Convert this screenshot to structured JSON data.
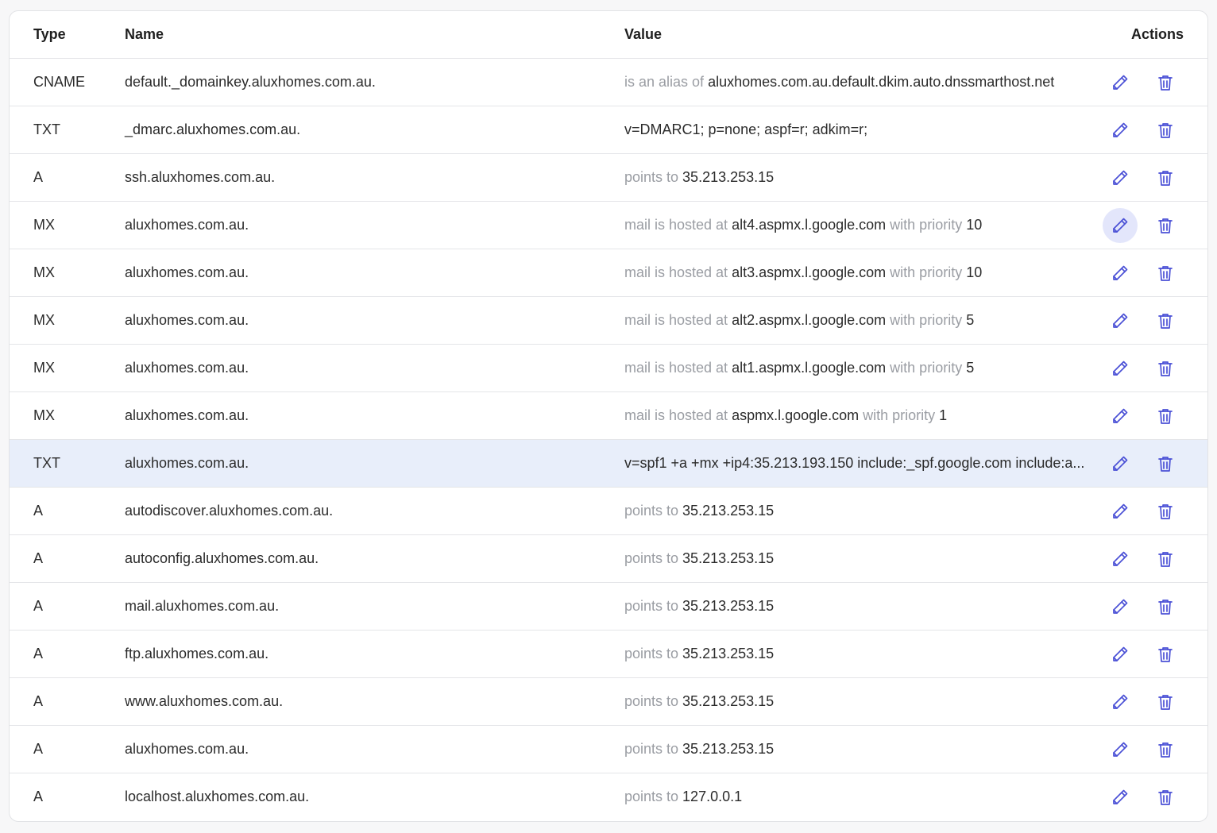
{
  "table": {
    "headers": {
      "type": "Type",
      "name": "Name",
      "value": "Value",
      "actions": "Actions"
    },
    "highlighted_row_index": 8,
    "active_edit_row_index": 3,
    "icon_color": "#4b51d6",
    "rows": [
      {
        "type": "CNAME",
        "name": "default._domainkey.aluxhomes.com.au.",
        "value_parts": [
          {
            "t": "is an alias of ",
            "muted": true
          },
          {
            "t": "aluxhomes.com.au.default.dkim.auto.dnssmarthost.net",
            "muted": false
          }
        ]
      },
      {
        "type": "TXT",
        "name": "_dmarc.aluxhomes.com.au.",
        "value_parts": [
          {
            "t": "v=DMARC1; p=none; aspf=r; adkim=r;",
            "muted": false
          }
        ]
      },
      {
        "type": "A",
        "name": "ssh.aluxhomes.com.au.",
        "value_parts": [
          {
            "t": "points to ",
            "muted": true
          },
          {
            "t": "35.213.253.15",
            "muted": false
          }
        ]
      },
      {
        "type": "MX",
        "name": "aluxhomes.com.au.",
        "value_parts": [
          {
            "t": "mail is hosted at ",
            "muted": true
          },
          {
            "t": "alt4.aspmx.l.google.com",
            "muted": false
          },
          {
            "t": " with priority ",
            "muted": true
          },
          {
            "t": "10",
            "muted": false
          }
        ]
      },
      {
        "type": "MX",
        "name": "aluxhomes.com.au.",
        "value_parts": [
          {
            "t": "mail is hosted at ",
            "muted": true
          },
          {
            "t": "alt3.aspmx.l.google.com",
            "muted": false
          },
          {
            "t": " with priority ",
            "muted": true
          },
          {
            "t": "10",
            "muted": false
          }
        ]
      },
      {
        "type": "MX",
        "name": "aluxhomes.com.au.",
        "value_parts": [
          {
            "t": "mail is hosted at ",
            "muted": true
          },
          {
            "t": "alt2.aspmx.l.google.com",
            "muted": false
          },
          {
            "t": " with priority ",
            "muted": true
          },
          {
            "t": "5",
            "muted": false
          }
        ]
      },
      {
        "type": "MX",
        "name": "aluxhomes.com.au.",
        "value_parts": [
          {
            "t": "mail is hosted at ",
            "muted": true
          },
          {
            "t": "alt1.aspmx.l.google.com",
            "muted": false
          },
          {
            "t": " with priority ",
            "muted": true
          },
          {
            "t": "5",
            "muted": false
          }
        ]
      },
      {
        "type": "MX",
        "name": "aluxhomes.com.au.",
        "value_parts": [
          {
            "t": "mail is hosted at ",
            "muted": true
          },
          {
            "t": "aspmx.l.google.com",
            "muted": false
          },
          {
            "t": " with priority ",
            "muted": true
          },
          {
            "t": "1",
            "muted": false
          }
        ]
      },
      {
        "type": "TXT",
        "name": "aluxhomes.com.au.",
        "value_parts": [
          {
            "t": "v=spf1 +a +mx +ip4:35.213.193.150 include:_spf.google.com include:a...",
            "muted": false
          }
        ]
      },
      {
        "type": "A",
        "name": "autodiscover.aluxhomes.com.au.",
        "value_parts": [
          {
            "t": "points to ",
            "muted": true
          },
          {
            "t": "35.213.253.15",
            "muted": false
          }
        ]
      },
      {
        "type": "A",
        "name": "autoconfig.aluxhomes.com.au.",
        "value_parts": [
          {
            "t": "points to ",
            "muted": true
          },
          {
            "t": "35.213.253.15",
            "muted": false
          }
        ]
      },
      {
        "type": "A",
        "name": "mail.aluxhomes.com.au.",
        "value_parts": [
          {
            "t": "points to ",
            "muted": true
          },
          {
            "t": "35.213.253.15",
            "muted": false
          }
        ]
      },
      {
        "type": "A",
        "name": "ftp.aluxhomes.com.au.",
        "value_parts": [
          {
            "t": "points to ",
            "muted": true
          },
          {
            "t": "35.213.253.15",
            "muted": false
          }
        ]
      },
      {
        "type": "A",
        "name": "www.aluxhomes.com.au.",
        "value_parts": [
          {
            "t": "points to ",
            "muted": true
          },
          {
            "t": "35.213.253.15",
            "muted": false
          }
        ]
      },
      {
        "type": "A",
        "name": "aluxhomes.com.au.",
        "value_parts": [
          {
            "t": "points to ",
            "muted": true
          },
          {
            "t": "35.213.253.15",
            "muted": false
          }
        ]
      },
      {
        "type": "A",
        "name": "localhost.aluxhomes.com.au.",
        "value_parts": [
          {
            "t": "points to ",
            "muted": true
          },
          {
            "t": "127.0.0.1",
            "muted": false
          }
        ]
      }
    ]
  }
}
